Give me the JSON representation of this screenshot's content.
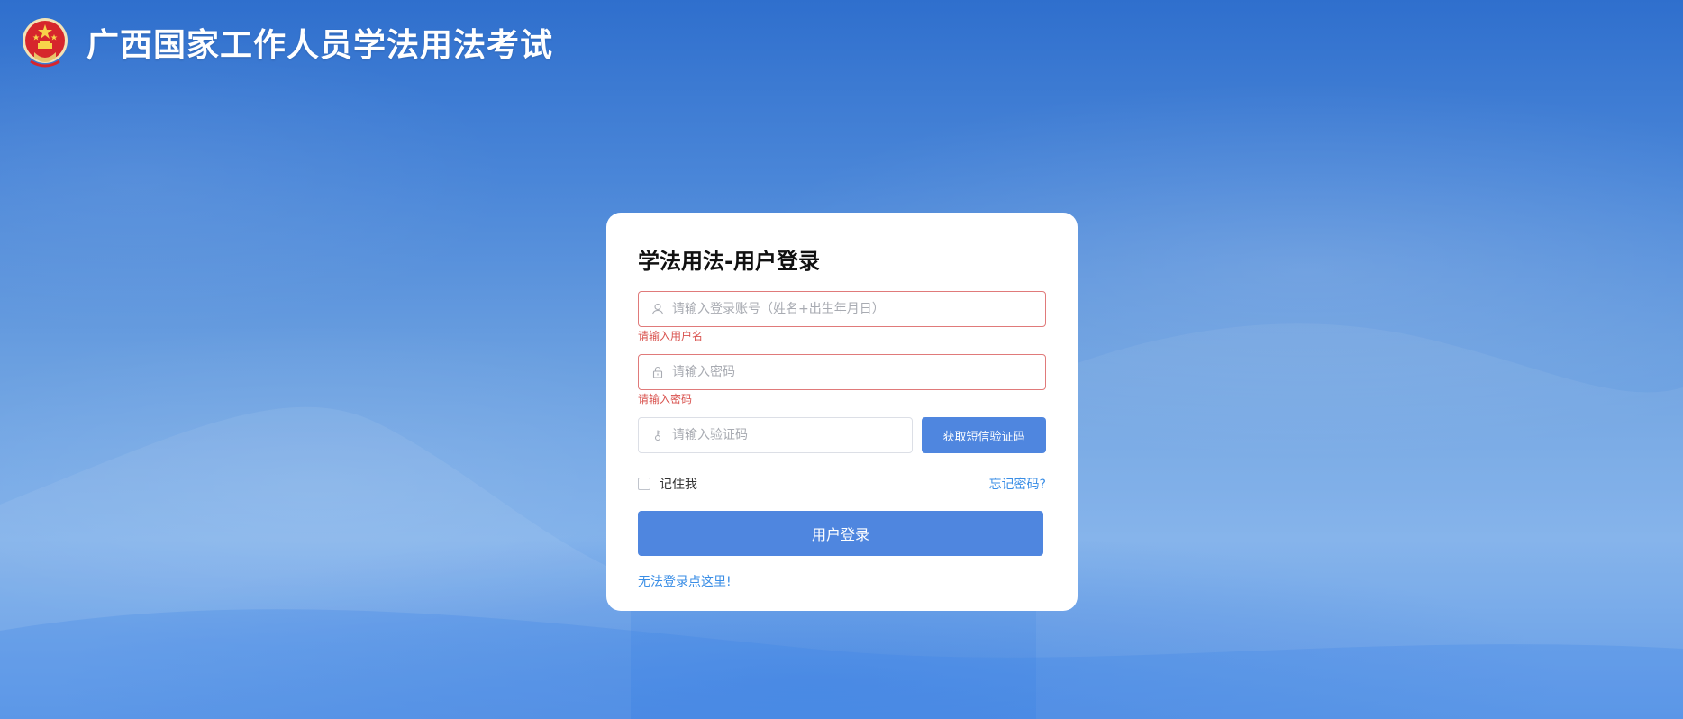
{
  "header": {
    "site_title": "广西国家工作人员学法用法考试",
    "emblem_icon": "national-emblem-icon"
  },
  "login": {
    "title": "学法用法-用户登录",
    "username": {
      "placeholder": "请输入登录账号（姓名+出生年月日）",
      "value": "",
      "error": "请输入用户名",
      "icon": "user-icon"
    },
    "password": {
      "placeholder": "请输入密码",
      "value": "",
      "error": "请输入密码",
      "icon": "lock-icon"
    },
    "verify_code": {
      "placeholder": "请输入验证码",
      "value": "",
      "icon": "key-icon"
    },
    "sms_button": "获取短信验证码",
    "remember_me": "记住我",
    "forgot_password": "忘记密码?",
    "login_button": "用户登录",
    "help_link": "无法登录点这里!"
  },
  "colors": {
    "primary_button": "#4f86df",
    "link": "#3a8ee6",
    "error": "#d9534f",
    "error_border": "#e07a7a"
  }
}
